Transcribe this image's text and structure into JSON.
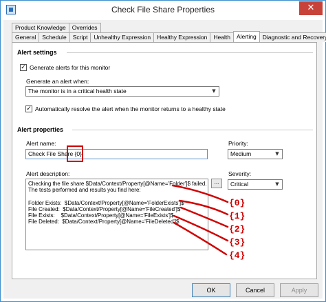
{
  "window": {
    "title": "Check File Share Properties",
    "close_glyph": "✕"
  },
  "tabs": {
    "row1": [
      "Product Knowledge",
      "Overrides"
    ],
    "row2": [
      "General",
      "Schedule",
      "Script",
      "Unhealthy Expression",
      "Healthy Expression",
      "Health",
      "Alerting",
      "Diagnostic and Recovery"
    ],
    "active": "Alerting"
  },
  "alert_settings": {
    "header": "Alert settings",
    "generate_alerts_label": "Generate alerts for this monitor",
    "generate_alerts_checked": true,
    "generate_when_label": "Generate an alert when:",
    "generate_when_value": "The monitor is in a critical health state",
    "auto_resolve_label": "Automatically resolve the alert when the monitor returns to a healthy state",
    "auto_resolve_checked": true
  },
  "alert_properties": {
    "header": "Alert properties",
    "name_label": "Alert name:",
    "name_value": "Check File Share {0}",
    "priority_label": "Priority:",
    "priority_value": "Medium",
    "description_label": "Alert description:",
    "description_lines": [
      "Checking the file share $Data/Context/Property[@Name='Folder']$ failed.",
      "The tests performed and results you find here:",
      "",
      "Folder Exists:  $Data/Context/Property[@Name='FolderExists']$",
      "File Created:  $Data/Context/Property[@Name='FileCreated']$",
      "File Exists:    $Data/Context/Property[@Name='FileExists']$",
      "File Deleted:  $Data/Context/Property[@Name='FileDeleted']$"
    ],
    "ellipsis_label": "...",
    "severity_label": "Severity:",
    "severity_value": "Critical"
  },
  "annotations": {
    "placeholders": [
      "{0}",
      "{1}",
      "{2}",
      "{3}",
      "{4}"
    ],
    "highlight_color": "#d00000"
  },
  "buttons": {
    "ok": "OK",
    "cancel": "Cancel",
    "apply": "Apply"
  },
  "icons": {
    "app": "properties-icon",
    "check": "✓",
    "combo_arrow": "▼"
  }
}
